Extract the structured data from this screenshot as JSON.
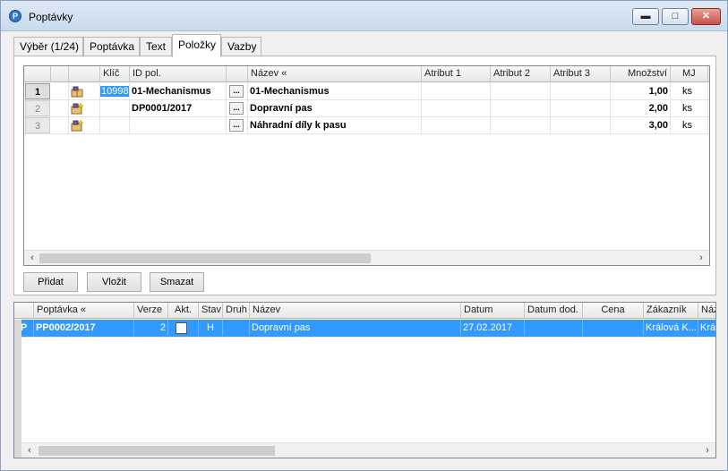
{
  "window": {
    "title": "Poptávky",
    "app_icon": "P"
  },
  "tabs": [
    {
      "label": "Výběr (1/24)"
    },
    {
      "label": "Poptávka"
    },
    {
      "label": "Text"
    },
    {
      "label": "Položky"
    },
    {
      "label": "Vazby"
    }
  ],
  "items_grid": {
    "headers": [
      "Klíč",
      "ID pol.",
      "Název «",
      "Atribut 1",
      "Atribut 2",
      "Atribut 3",
      "Množství",
      "MJ"
    ],
    "rows": [
      {
        "num": "1",
        "klic": "10998",
        "id": "01-Mechanismus",
        "nazev": "01-Mechanismus",
        "mnozstvi": "1,00",
        "mj": "ks"
      },
      {
        "num": "2",
        "klic": "",
        "id": "DP0001/2017",
        "nazev": "Dopravní pas",
        "mnozstvi": "2,00",
        "mj": "ks"
      },
      {
        "num": "3",
        "klic": "",
        "id": "",
        "nazev": "Náhradní díly k pasu",
        "mnozstvi": "3,00",
        "mj": "ks"
      }
    ],
    "dots_label": "..."
  },
  "buttons": {
    "add": "Přidat",
    "insert": "Vložit",
    "delete": "Smazat"
  },
  "bottom_grid": {
    "headers": [
      "Poptávka «",
      "Verze",
      "Akt.",
      "Stav",
      "Druh",
      "Název",
      "Datum",
      "Datum dod.",
      "Cena",
      "Zákazník",
      "Náz"
    ],
    "rows": [
      {
        "marker": "P",
        "poptavka": "PP0002/2017",
        "verze": "2",
        "stav": "H",
        "druh": "",
        "nazev": "Dopravní pas",
        "datum": "27.02.2017",
        "datum_dod": "",
        "cena": "",
        "zakaznik": "Králová K...",
        "naz": "Král"
      }
    ]
  },
  "colors": {
    "selection": "#3399ff",
    "key_highlight": "#3399ff"
  }
}
